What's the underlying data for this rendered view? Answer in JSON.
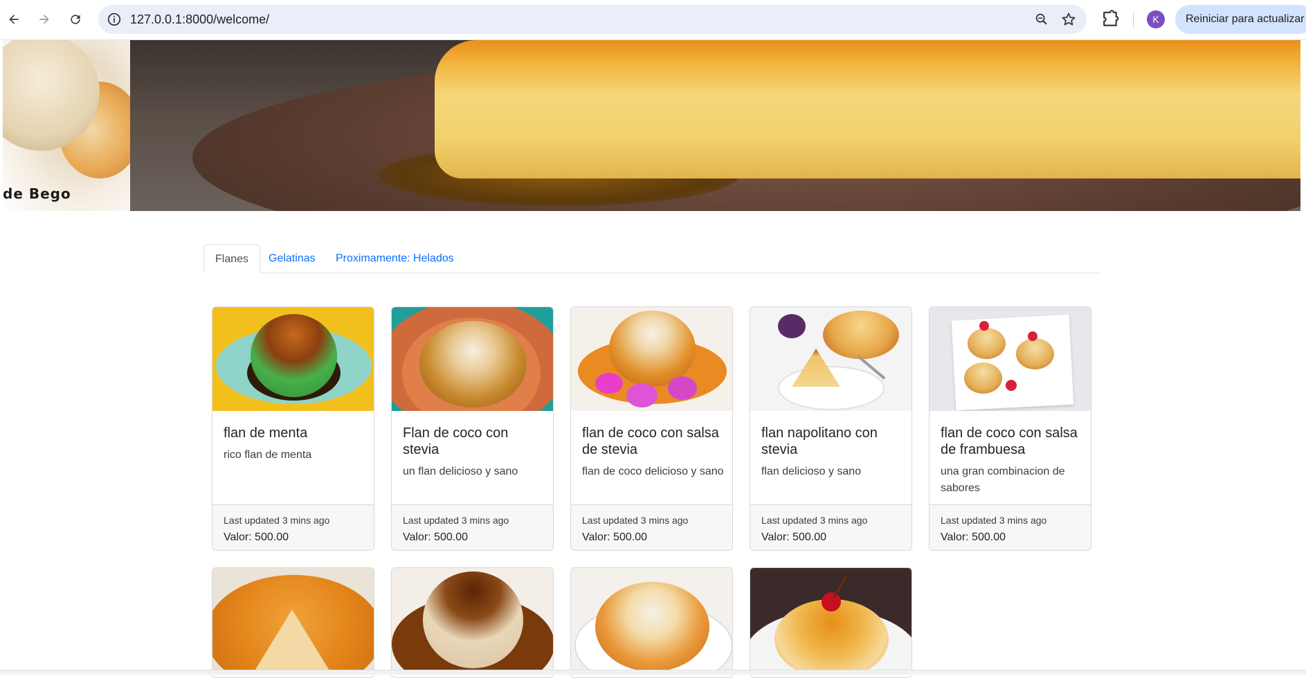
{
  "browser": {
    "url": "127.0.0.1:8000/welcome/",
    "profile_initial": "K",
    "update_button": "Reiniciar para actualizar"
  },
  "hero": {
    "caption": "de Bego"
  },
  "tabs": [
    {
      "label": "Flanes",
      "active": true
    },
    {
      "label": "Gelatinas",
      "active": false
    },
    {
      "label": "Proximamente: Helados",
      "active": false
    }
  ],
  "cards": [
    {
      "title": "flan de menta",
      "text": "rico flan de menta",
      "updated": "Last updated 3 mins ago",
      "price": "Valor: 500.00"
    },
    {
      "title": "Flan de coco con stevia",
      "text": "un flan delicioso y sano",
      "updated": "Last updated 3 mins ago",
      "price": "Valor: 500.00"
    },
    {
      "title": "flan de coco con salsa de stevia",
      "text": "flan de coco delicioso y sano",
      "updated": "Last updated 3 mins ago",
      "price": "Valor: 500.00"
    },
    {
      "title": "flan napolitano con stevia",
      "text": "flan delicioso y sano",
      "updated": "Last updated 3 mins ago",
      "price": "Valor: 500.00"
    },
    {
      "title": "flan de coco con salsa de frambuesa",
      "text": "una gran combinacion de sabores",
      "updated": "Last updated 3 mins ago",
      "price": "Valor: 500.00"
    }
  ],
  "colors": {
    "link": "#0d6efd",
    "avatar": "#7d4dc4",
    "update_button_bg": "#d3e3fd"
  }
}
